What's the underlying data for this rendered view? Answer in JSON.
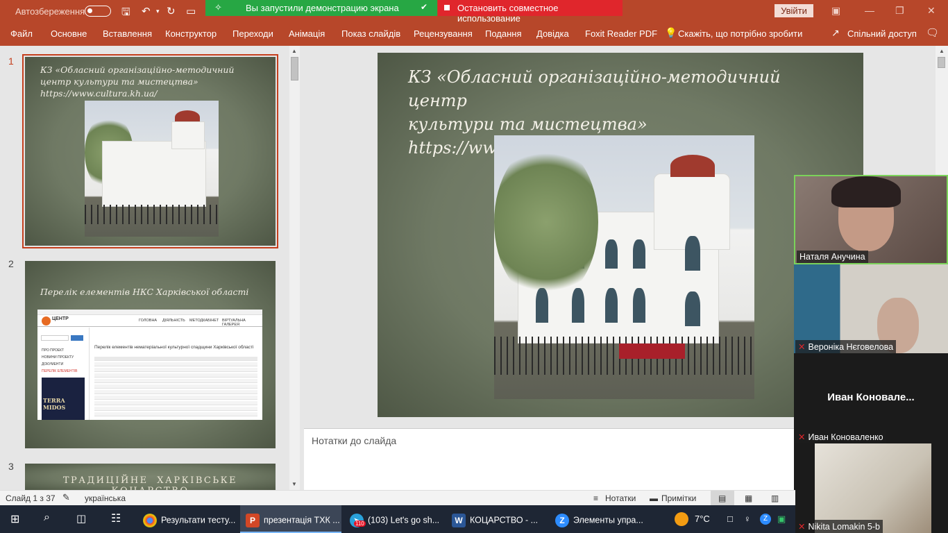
{
  "titlebar": {
    "autosave_label": "Автозбереження",
    "share_status": "Вы запустили демонстрацию экрана",
    "stop_share": "Остановить совместное использование",
    "login_button": "Увійти"
  },
  "ribbon": {
    "tabs": [
      "Файл",
      "Основне",
      "Вставлення",
      "Конструктор",
      "Переходи",
      "Анімація",
      "Показ слайдів",
      "Рецензування",
      "Подання",
      "Довідка",
      "Foxit Reader PDF"
    ],
    "tell_me": "Скажіть, що потрібно зробити",
    "share": "Спільний доступ"
  },
  "thumbnails": [
    {
      "number": "1",
      "title": "КЗ «Обласний організаційно-методичний центр культури та мистецтва» https://www.cultura.kh.ua/"
    },
    {
      "number": "2",
      "title": "Перелік елементів НКС Харківської області",
      "site_logo": "ЦЕНТР",
      "site_nav": [
        "ГОЛОВНА",
        "ДІЯЛЬНІСТЬ",
        "МЕТОДКАБІНЕТ",
        "ВІРТУАЛЬНА ГАЛЕРЕЯ"
      ],
      "site_menu": [
        "ПРО ПРОЕКТ",
        "НОВИНИ ПРОЕКТУ",
        "ДОКУМЕНТИ",
        "ПЕРЕЛІК ЕЛЕМЕНТІВ"
      ],
      "site_heading": "Перелік елементів нематеріальної культурної спадщини Харківської області",
      "book_title": "TERRA MIDOS"
    },
    {
      "number": "3",
      "title": "ТРАДИЦІЙНЕ ХАРКІВСЬКЕ КОЦАРСТВО"
    }
  ],
  "slide": {
    "title_line1": "КЗ «Обласний організаційно-методичний центр",
    "title_line2": "культури та мистецтва»",
    "title_line3": "https://www.cultura.kh.ua/"
  },
  "notes_placeholder": "Нотатки до слайда",
  "participants": [
    {
      "name": "Наталя Анучина",
      "muted": false
    },
    {
      "name": "Вероніка Нєговелова",
      "muted": true
    },
    {
      "name": "Иван Коноваленко",
      "display": "Иван  Коновале...",
      "muted": true
    },
    {
      "name": "Nikita Lomakin 5-b",
      "muted": true
    }
  ],
  "statusbar": {
    "slide_counter": "Слайд 1 з 37",
    "language": "українська",
    "notes_button": "Нотатки",
    "comments_button": "Примітки"
  },
  "taskbar": {
    "items": [
      {
        "label": "Результати тесту...",
        "icon": "chrome-icon"
      },
      {
        "label": "презентація ТХК ...",
        "icon": "powerpoint-icon"
      },
      {
        "label": "(103) Let's go sh...",
        "icon": "telegram-icon",
        "badge": "110"
      },
      {
        "label": "КОЦАРСТВО - ...",
        "icon": "word-icon"
      },
      {
        "label": "Элементы упра...",
        "icon": "zoom-icon"
      }
    ],
    "temperature": "7°C"
  },
  "colors": {
    "accent": "#b7472a",
    "share_green": "#27a744",
    "share_red": "#e0262c",
    "slide_bg": "#6f7964"
  }
}
